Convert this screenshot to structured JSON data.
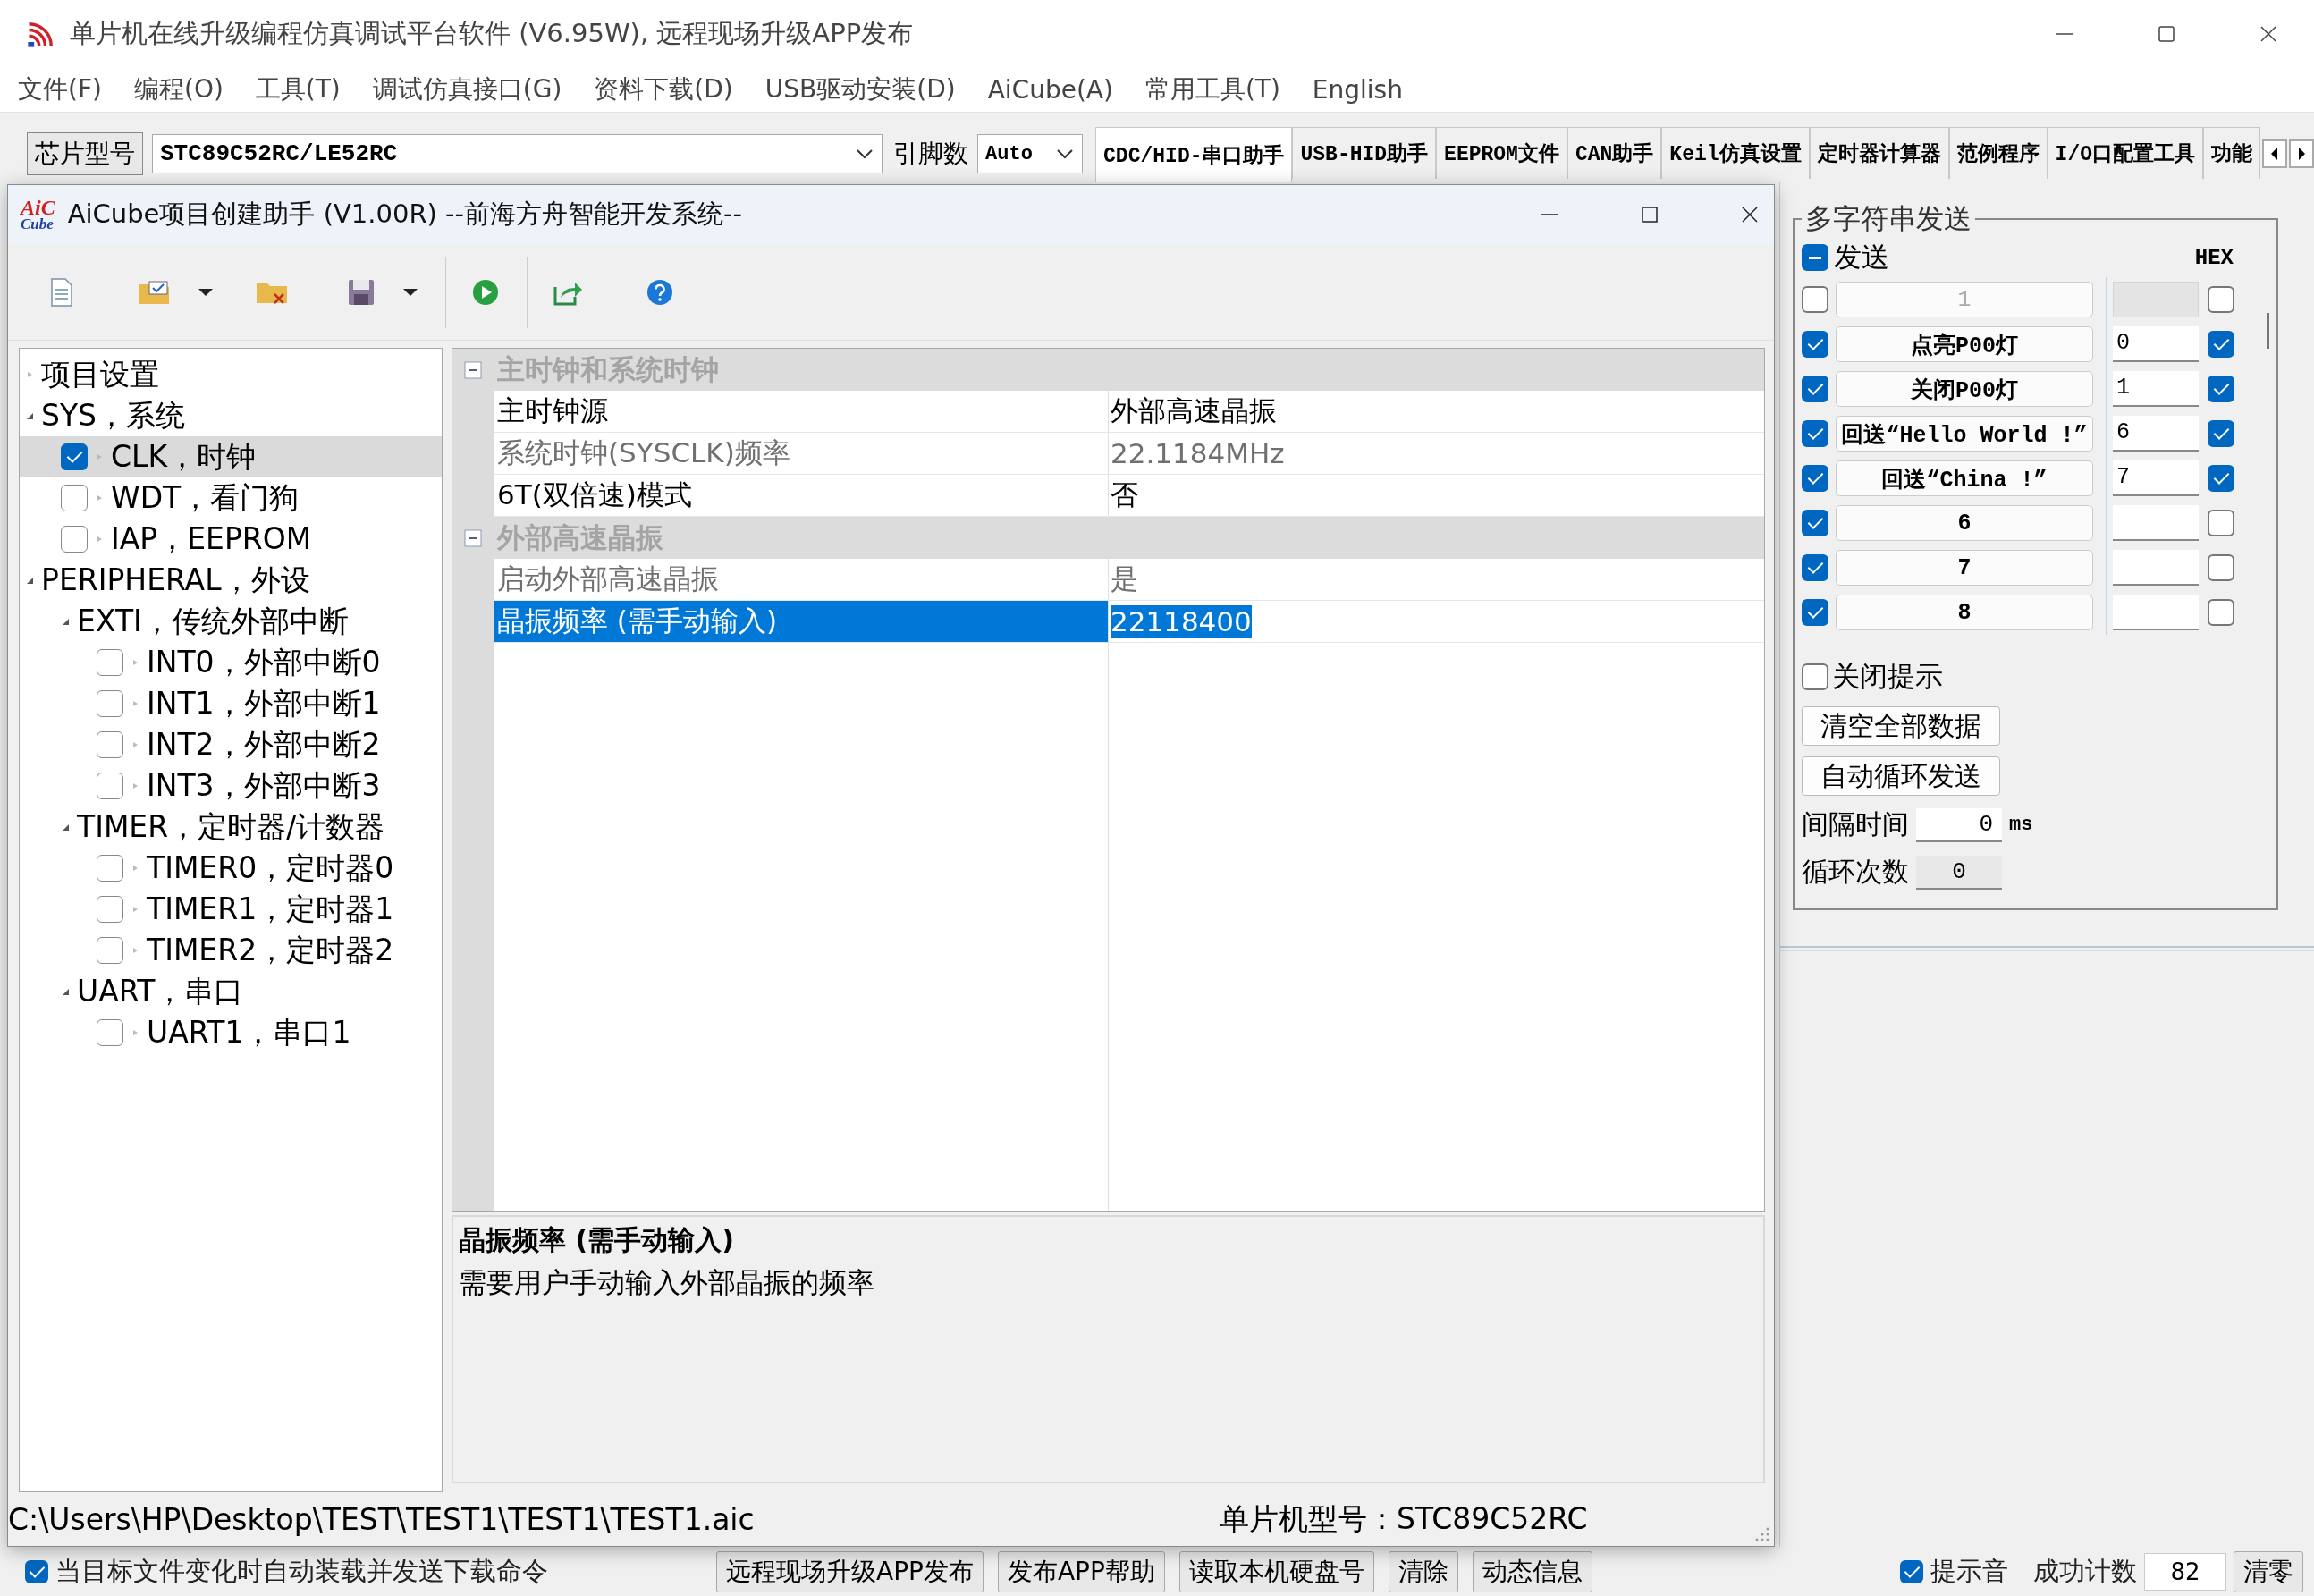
{
  "app": {
    "title": "单片机在线升级编程仿真调试平台软件 (V6.95W), 远程现场升级APP发布"
  },
  "menu": [
    "文件(F)",
    "编程(O)",
    "工具(T)",
    "调试仿真接口(G)",
    "资料下载(D)",
    "USB驱动安装(D)",
    "AiCube(A)",
    "常用工具(T)",
    "English"
  ],
  "toolbar": {
    "chip_button": "芯片型号",
    "chip_value": "STC89C52RC/LE52RC",
    "pins_label": "引脚数",
    "pins_value": "Auto",
    "tabs": [
      {
        "label": "CDC/HID-串口助手",
        "selected": true
      },
      {
        "label": "USB-HID助手",
        "selected": false
      },
      {
        "label": "EEPROM文件",
        "selected": false
      },
      {
        "label": "CAN助手",
        "selected": false
      },
      {
        "label": "Keil仿真设置",
        "selected": false
      },
      {
        "label": "定时器计算器",
        "selected": false
      },
      {
        "label": "范例程序",
        "selected": false
      },
      {
        "label": "I/O口配置工具",
        "selected": false
      },
      {
        "label": "功能",
        "selected": false
      }
    ]
  },
  "send_panel": {
    "title": "多字符串发送",
    "send_label": "发送",
    "send_indeterminate": true,
    "hex_label": "HEX",
    "rows": [
      {
        "checked": false,
        "label": "1",
        "disabled": true,
        "hex": false
      },
      {
        "checked": true,
        "label": "点亮P00灯",
        "value": "0",
        "disabled": false,
        "hex": true
      },
      {
        "checked": true,
        "label": "关闭P00灯",
        "value": "1",
        "disabled": false,
        "hex": true
      },
      {
        "checked": true,
        "label": "回送“Hello World !”",
        "value": "6",
        "disabled": false,
        "hex": true
      },
      {
        "checked": true,
        "label": "回送“China !”",
        "value": "7",
        "disabled": false,
        "hex": true
      },
      {
        "checked": true,
        "label": "6",
        "disabled": false,
        "hex": false
      },
      {
        "checked": true,
        "label": "7",
        "disabled": false,
        "hex": false
      },
      {
        "checked": true,
        "label": "8",
        "disabled": false,
        "hex": false
      }
    ],
    "close_tip": {
      "label": "关闭提示",
      "checked": false
    },
    "buttons": [
      "清空全部数据",
      "自动循环发送"
    ],
    "interval": {
      "label": "间隔时间",
      "value": "0",
      "unit": "ms"
    },
    "loop": {
      "label": "循环次数",
      "value": "0"
    }
  },
  "bottom_bar": {
    "auto_reload": {
      "label": "当目标文件变化时自动装载并发送下载命令",
      "checked": true
    },
    "buttons": [
      "远程现场升级APP发布",
      "发布APP帮助",
      "读取本机硬盘号",
      "清除",
      "动态信息"
    ],
    "sound": {
      "label": "提示音",
      "checked": true
    },
    "count_label": "成功计数",
    "count": "82",
    "reset_button": "清零"
  },
  "dialog": {
    "logo": [
      "AiC",
      "Cube"
    ],
    "title": "AiCube项目创建助手 (V1.00R) --前海方舟智能开发系统--",
    "tree": [
      {
        "kind": "group",
        "label": "项目设置",
        "expanded": false,
        "selected": false
      },
      {
        "kind": "group",
        "label": "SYS，系统",
        "expanded": true,
        "selected": false,
        "children": [
          {
            "kind": "check",
            "label": "CLK，时钟",
            "checked": true,
            "selected": true
          },
          {
            "kind": "check",
            "label": "WDT，看门狗",
            "checked": false,
            "selected": false
          },
          {
            "kind": "check",
            "label": "IAP，EEPROM",
            "checked": false,
            "selected": false
          }
        ]
      },
      {
        "kind": "group",
        "label": "PERIPHERAL，外设",
        "expanded": true,
        "selected": false,
        "children": [
          {
            "kind": "group",
            "label": "EXTI，传统外部中断",
            "expanded": true,
            "selected": false,
            "children": [
              {
                "kind": "check",
                "label": "INT0，外部中断0",
                "checked": false,
                "selected": false
              },
              {
                "kind": "check",
                "label": "INT1，外部中断1",
                "checked": false,
                "selected": false
              },
              {
                "kind": "check",
                "label": "INT2，外部中断2",
                "checked": false,
                "selected": false
              },
              {
                "kind": "check",
                "label": "INT3，外部中断3",
                "checked": false,
                "selected": false
              }
            ]
          },
          {
            "kind": "group",
            "label": "TIMER，定时器/计数器",
            "expanded": true,
            "selected": false,
            "children": [
              {
                "kind": "check",
                "label": "TIMER0，定时器0",
                "checked": false,
                "selected": false
              },
              {
                "kind": "check",
                "label": "TIMER1，定时器1",
                "checked": false,
                "selected": false
              },
              {
                "kind": "check",
                "label": "TIMER2，定时器2",
                "checked": false,
                "selected": false
              }
            ]
          },
          {
            "kind": "group",
            "label": "UART，串口",
            "expanded": true,
            "selected": false,
            "children": [
              {
                "kind": "check",
                "label": "UART1，串口1",
                "checked": false,
                "selected": false
              }
            ]
          }
        ]
      }
    ],
    "properties": [
      {
        "title": "主时钟和系统时钟",
        "expanded": true,
        "rows": [
          {
            "name": "主时钟源",
            "value": "外部高速晶振",
            "readonly": false,
            "selected": false
          },
          {
            "name": "系统时钟(SYSCLK)频率",
            "value": "22.1184MHz",
            "readonly": true,
            "selected": false
          },
          {
            "name": "6T(双倍速)模式",
            "value": "否",
            "readonly": false,
            "selected": false
          }
        ]
      },
      {
        "title": "外部高速晶振",
        "expanded": true,
        "rows": [
          {
            "name": "启动外部高速晶振",
            "value": "是",
            "readonly": true,
            "selected": false
          },
          {
            "name": "晶振频率 (需手动输入)",
            "value": "22118400",
            "readonly": false,
            "selected": true
          }
        ]
      }
    ],
    "description": {
      "title": "晶振频率 (需手动输入)",
      "text": "需要用户手动输入外部晶振的频率"
    },
    "status": {
      "path": "C:\\Users\\HP\\Desktop\\TEST\\TEST1\\TEST1\\TEST1.aic",
      "chip": "单片机型号：STC89C52RC"
    }
  }
}
